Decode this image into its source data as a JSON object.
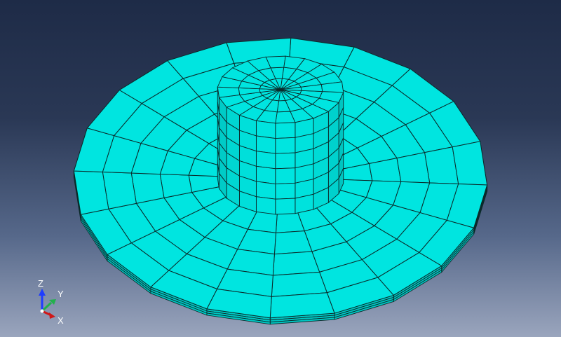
{
  "viewport": {
    "mesh_color": "#00e5e0",
    "mesh_edge_color": "#0a2a2a",
    "background_top": "#1e2b47",
    "background_bottom": "#9aa5bd"
  },
  "model": {
    "flange_segments": 20,
    "flange_rings": 5,
    "flange_layers": 3,
    "cylinder_segments": 20,
    "cylinder_rings": 3,
    "cylinder_height_divisions": 6
  },
  "triad": {
    "z_label": "Z",
    "y_label": "Y",
    "x_label": "X",
    "z_color": "#1f3cff",
    "y_color": "#22b14c",
    "x_color": "#d01818"
  }
}
